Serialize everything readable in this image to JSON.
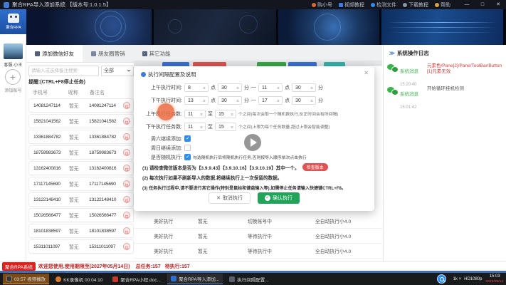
{
  "title_bar": {
    "app_title": "聚合RPA导入添加系统 【版本号:1.0.1.5】",
    "menu": [
      {
        "label": "购小号",
        "icon": "cart-icon",
        "color": "#d96a2b"
      },
      {
        "label": "视频教程",
        "icon": "video-doc-icon",
        "color": "#3f7bd6"
      },
      {
        "label": "检测文件",
        "icon": "file-check-icon",
        "color": "#2d8cf0"
      },
      {
        "label": "下载教程",
        "icon": "download-icon",
        "color": "#8a93a6"
      },
      {
        "label": "帮助",
        "icon": "help-icon",
        "color": "#d9a43b"
      }
    ],
    "minimize": "—",
    "maximize": "□",
    "close": "✕"
  },
  "sidebar": {
    "logo_text": "聚合RPA",
    "account_name": "客服-小王",
    "add_plus": "+",
    "add_label": "添加账号"
  },
  "tabs": [
    {
      "label": "添加微信好友"
    },
    {
      "label": "朋友圈营销"
    },
    {
      "label": "其它功能"
    }
  ],
  "filter": {
    "search_placeholder": "请输入或选择备注搜索",
    "select_value": "全部",
    "hint": "提醒:(CTRL+F8停止任务)"
  },
  "table": {
    "headers": [
      "手机号",
      "昵称",
      "备注名"
    ],
    "rows": [
      {
        "phone": "14081247114",
        "nick": "暂无",
        "remark": "14081247114"
      },
      {
        "phone": "15821041562",
        "nick": "暂无",
        "remark": "15821041562"
      },
      {
        "phone": "13361884782",
        "nick": "暂无",
        "remark": "13361884782"
      },
      {
        "phone": "18759983673",
        "nick": "暂无",
        "remark": "18759983673"
      },
      {
        "phone": "13162400816",
        "nick": "暂无",
        "remark": "13162400816"
      },
      {
        "phone": "17117145690",
        "nick": "暂无",
        "remark": "17117145690"
      },
      {
        "phone": "13122148410",
        "nick": "暂无",
        "remark": "13122148410"
      },
      {
        "phone": "15026566477",
        "nick": "暂无",
        "remark": "15026566477"
      },
      {
        "phone": "18101838597",
        "nick": "暂无",
        "remark": "18101838597"
      },
      {
        "phone": "15311011097",
        "nick": "暂无",
        "remark": "15311011097"
      }
    ]
  },
  "exec_rows": [
    {
      "c1": "美好执行",
      "c2": "暂无",
      "c3": "切换账号中",
      "c4": "全自动执行小4.0"
    },
    {
      "c1": "美好执行",
      "c2": "暂无",
      "c3": "等待执行中",
      "c4": "全自动执行小4.0"
    },
    {
      "c1": "美好执行",
      "c2": "暂无",
      "c3": "等待执行中",
      "c4": "全自动执行小4.0"
    }
  ],
  "dialog": {
    "title": "执行间隔配置及说明",
    "close": "✕",
    "units": {
      "hour": "点",
      "minute": "分",
      "dash": "—",
      "to": "至"
    },
    "time_rows": [
      {
        "label": "上午执行时间:",
        "h1": "8",
        "m1": "30",
        "h2": "11",
        "m2": "30"
      },
      {
        "label": "下午执行时间:",
        "h1": "13",
        "m1": "30",
        "h2": "17",
        "m2": "30"
      }
    ],
    "task_rows": [
      {
        "label": "上午执行任务数:",
        "v1": "11",
        "v2": "15",
        "note": "个之间(每次会取一个随机数执行,反正时间会有所间隔)"
      },
      {
        "label": "下午执行任务数:",
        "v1": "11",
        "v2": "15",
        "note": "个之间(上限为每个任务数量,超过上限会智能调整)"
      }
    ],
    "checks": [
      {
        "label": "周六继续添加:",
        "checked": true,
        "note": ""
      },
      {
        "label": "周日继续添加:",
        "checked": false,
        "note": ""
      },
      {
        "label": "是否随机执行:",
        "checked": true,
        "note": "勾选随机执行后将随机执行任务,否则按导入顺序依次点击执行"
      }
    ],
    "notes": [
      {
        "text": "(1) 请检查微信版本是否为【3.9.9.43】【3.9.10.16】【3.9.10.19】其中一个。",
        "button": "检查版本"
      },
      {
        "text": "(2) 每次执行如果不刷新导入的数据,将继续执行上一次保留的数据。",
        "button": ""
      },
      {
        "text": "(3) 任务执行过程中,请不要进行其它操作(特别是鼠标和键盘输入等),如需停止任务请输入快捷键CTRL+F8。",
        "button": ""
      }
    ],
    "cancel_label": "取消执行",
    "confirm_label": "确认执行",
    "cancel_x": "✕",
    "confirm_check": "✓"
  },
  "log_panel": {
    "title": "系统操作日志",
    "chevron": "≫",
    "entries": [
      {
        "sender": "系统消息",
        "time": "15:20:40",
        "message": "元素色/Pane[2]/Pane/ToolBar/Button[1]元素无效",
        "status": "error"
      },
      {
        "sender": "系统消息",
        "time": "15:01:42",
        "message": "开始循环挂机检测",
        "status": "info"
      }
    ]
  },
  "status_bar": {
    "badge": "聚合RPA系统",
    "welcome": "欢迎您使用,使用期限至(2027年05月14日)",
    "task_total": "总任务:157",
    "task_pending": "待执行:157"
  },
  "taskbar": {
    "items": [
      {
        "label": "03:57 视频播放",
        "type": "video"
      },
      {
        "label": "KK录像机 00:04:10",
        "type": "recorder"
      },
      {
        "label": "聚合RPA小程.doc...",
        "type": "word"
      },
      {
        "label": "聚合RPA导入添加...",
        "type": "app"
      },
      {
        "label": "执行间隔配置...",
        "type": "dialog"
      }
    ],
    "tray": {
      "volume": "1k ×",
      "resolution": "HD1080p",
      "clock": "15:03",
      "date": "2023/05/14"
    }
  },
  "colors": {
    "accent_blue": "#2d8cf0",
    "confirm_green": "#21a35a",
    "alert_red": "#e05353",
    "seg_colors": [
      "#3a6fd0",
      "#d9534f",
      "#3aa54a",
      "#3a6fd0",
      "#35b0a8"
    ]
  }
}
